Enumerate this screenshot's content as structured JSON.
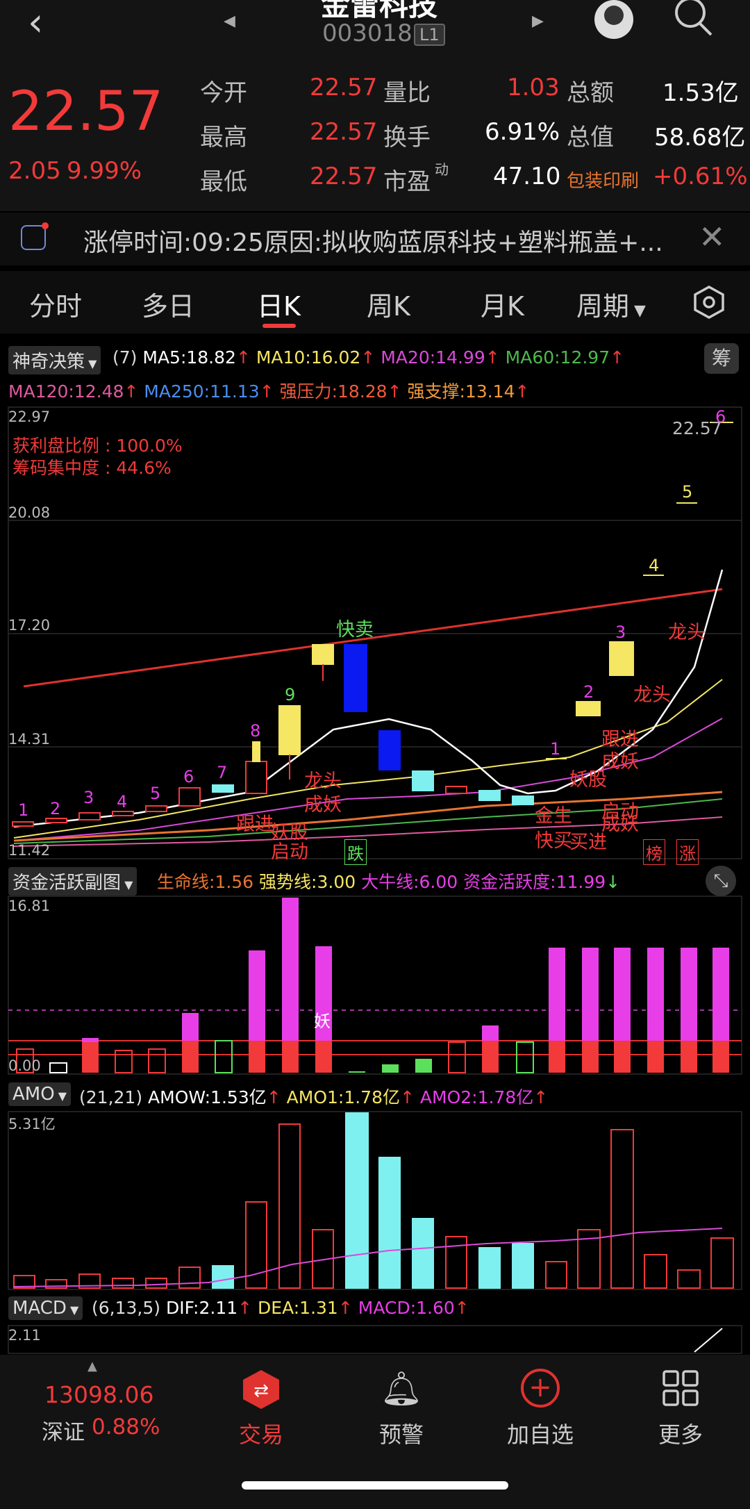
{
  "header": {
    "title": "金雷科技",
    "code": "003018",
    "level": "L1"
  },
  "quote": {
    "price": "22.57",
    "change": "2.05",
    "change_pct": "9.99%",
    "open_label": "今开",
    "open": "22.57",
    "high_label": "最高",
    "high": "22.57",
    "low_label": "最低",
    "low": "22.57",
    "volratio_label": "量比",
    "volratio": "1.03",
    "turnover_label": "换手",
    "turnover": "6.91%",
    "pe_label": "市盈",
    "pe_sup": "动",
    "pe": "47.10",
    "amount_label": "总额",
    "amount": "1.53亿",
    "mktcap_label": "总值",
    "mktcap": "58.68亿",
    "sector": "包装印刷",
    "sector_pct": "+0.61%"
  },
  "notice": {
    "text": "涨停时间:09:25原因:拟收购蓝原科技+塑料瓶盖+..."
  },
  "tabs": [
    "分时",
    "多日",
    "日K",
    "周K",
    "月K",
    "周期"
  ],
  "main_chart": {
    "indicator_name": "神奇决策",
    "period": "(7)",
    "ma5": "MA5:18.82",
    "ma10": "MA10:16.02",
    "ma20": "MA20:14.99",
    "ma60": "MA60:12.97",
    "ma120": "MA120:12.48",
    "ma250": "MA250:11.13",
    "pressure": "强压力:18.28",
    "support": "强支撑:13.14",
    "chip_label_btn": "筹",
    "profit_ratio": "获利盘比例 : 100.0%",
    "chip_conc": "筹码集中度 : 44.6%",
    "y_ticks": [
      "22.97",
      "20.08",
      "17.20",
      "14.31",
      "11.42"
    ],
    "last_price_label": "22.57",
    "annotations": [
      "快卖",
      "龙头",
      "成妖",
      "跟进",
      "妖股",
      "启动",
      "金生",
      "快买",
      "买进",
      "成妖",
      "龙头",
      "龙头",
      "跟进",
      "妖股",
      "启动",
      "成妖"
    ],
    "tags": [
      "跌",
      "榜",
      "涨"
    ]
  },
  "fund_chart": {
    "name": "资金活跃副图",
    "life": "生命线:1.56",
    "strong": "强势线:3.00",
    "bull": "大牛线:6.00",
    "active": "资金活跃度:11.99",
    "y_top": "16.81",
    "y_bottom": "0.00",
    "demon": "妖"
  },
  "amo_chart": {
    "name": "AMO",
    "params": "(21,21)",
    "amow": "AMOW:1.53亿",
    "amo1": "AMO1:1.78亿",
    "amo2": "AMO2:1.78亿",
    "y_top": "5.31亿"
  },
  "macd_chart": {
    "name": "MACD",
    "params": "(6,13,5)",
    "dif": "DIF:2.11",
    "dea": "DEA:1.31",
    "macd": "MACD:1.60",
    "y_top": "2.11"
  },
  "bottom_nav": {
    "index_value": "13098.06",
    "index_name": "深证",
    "index_pct": "0.88%",
    "trade": "交易",
    "alert": "预警",
    "add": "加自选",
    "more": "更多"
  }
}
